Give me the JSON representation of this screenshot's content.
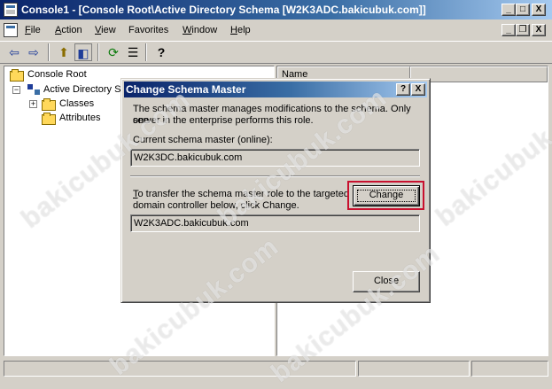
{
  "window": {
    "title": "Console1 - [Console Root\\Active Directory Schema [W2K3ADC.bakicubuk.com]]",
    "controls": {
      "minimize": "_",
      "maximize": "□",
      "close": "X"
    },
    "mdi_controls": {
      "minimize": "_",
      "restore": "❐",
      "close": "X"
    }
  },
  "menu": {
    "items": [
      {
        "key": "F",
        "rest": "ile"
      },
      {
        "key": "A",
        "rest": "ction"
      },
      {
        "key": "V",
        "rest": "iew"
      },
      {
        "key": "",
        "rest": "Favorites"
      },
      {
        "key": "W",
        "rest": "indow"
      },
      {
        "key": "H",
        "rest": "elp"
      }
    ]
  },
  "toolbar": {
    "back": "⇦",
    "forward": "⇨",
    "up": "⬆",
    "show_hide": "◧",
    "refresh": "⟳",
    "export": "☰",
    "help": "?"
  },
  "tree": {
    "root": "Console Root",
    "schema": "Active Directory Sc",
    "classes": "Classes",
    "attributes": "Attributes",
    "expand_sign": "+",
    "collapse_sign": "−"
  },
  "right_pane": {
    "column_header": "Name"
  },
  "dialog": {
    "title": "Change Schema Master",
    "help_btn": "?",
    "close_btn": "X",
    "description_line1": "The schema master manages modifications to the schema. Only one",
    "description_line2": "server in the enterprise performs this role.",
    "current_label": "Current schema master (online):",
    "current_value": "W2K3DC.bakicubuk.com",
    "transfer_line1": "To transfer the schema master role to the targeted",
    "transfer_line2": "domain controller below, click Change.",
    "target_value": "W2K3ADC.bakicubuk.com",
    "change_label": "Change",
    "close_label": "Close"
  },
  "watermark": {
    "text": "bakicubuk.com"
  },
  "colors": {
    "highlight": "#c8102e",
    "title_active": "#0a246a"
  }
}
